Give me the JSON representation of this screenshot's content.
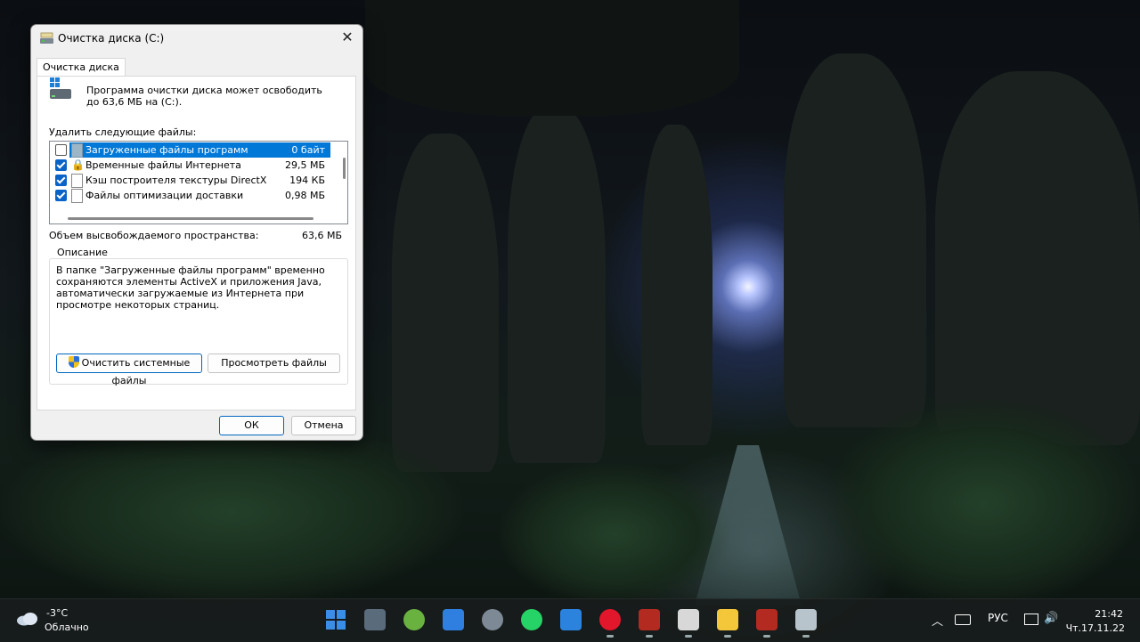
{
  "window": {
    "title": "Очистка диска  (C:)",
    "tab_label": "Очистка диска",
    "intro_text": "Программа очистки диска может освободить до 63,6 МБ на  (C:).",
    "list_label": "Удалить следующие файлы:",
    "files": [
      {
        "name": "Загруженные файлы программ",
        "size": "0 байт",
        "checked": false,
        "selected": true
      },
      {
        "name": "Временные файлы Интернета",
        "size": "29,5 МБ",
        "checked": true,
        "selected": false
      },
      {
        "name": "Кэш построителя текстуры DirectX",
        "size": "194 КБ",
        "checked": true,
        "selected": false
      },
      {
        "name": "Файлы оптимизации доставки",
        "size": "0,98 МБ",
        "checked": true,
        "selected": false
      }
    ],
    "space_label": "Объем высвобождаемого пространства:",
    "space_value": "63,6 МБ",
    "description_title": "Описание",
    "description_text": "В папке \"Загруженные файлы программ\" временно сохраняются элементы ActiveX и приложения Java, автоматически загружаемые из Интернета при просмотре некоторых страниц.",
    "clean_system_button": "Очистить системные файлы",
    "view_files_button": "Просмотреть файлы",
    "ok_button": "ОК",
    "cancel_button": "Отмена"
  },
  "taskbar": {
    "weather_temp": "-3°C",
    "weather_desc": "Облачно",
    "apps": [
      {
        "icon": "windows-start-icon",
        "color": "#3a8ee6"
      },
      {
        "icon": "remote-desktop-icon",
        "color": "#5a6b7c"
      },
      {
        "icon": "utorrent-icon",
        "color": "#6ab23f"
      },
      {
        "icon": "microsoft-store-icon",
        "color": "#2f7fe0"
      },
      {
        "icon": "settings-gear-icon",
        "color": "#7d8a96"
      },
      {
        "icon": "whatsapp-icon",
        "color": "#25d366"
      },
      {
        "icon": "mail-icon",
        "color": "#2c83dd"
      },
      {
        "icon": "opera-icon",
        "color": "#e3172b"
      },
      {
        "icon": "acrobat-reader-icon",
        "color": "#b32a20"
      },
      {
        "icon": "writing-app-icon",
        "color": "#d8d8d8"
      },
      {
        "icon": "file-explorer-icon",
        "color": "#f4c73a"
      },
      {
        "icon": "acrobat-reader-icon",
        "color": "#b32a20"
      },
      {
        "icon": "disk-cleanup-icon",
        "color": "#b8c4cc"
      }
    ],
    "language": "РУС",
    "time": "21:42",
    "date": "Чт.17.11.22"
  }
}
